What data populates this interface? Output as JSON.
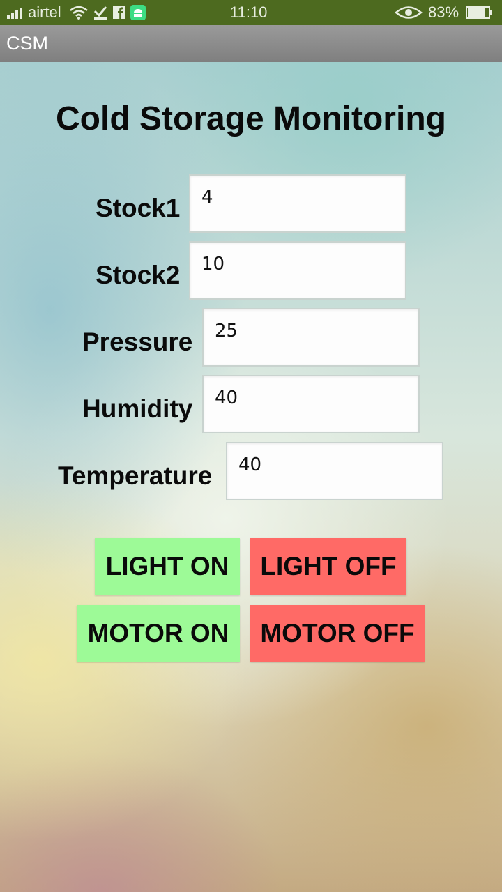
{
  "status_bar": {
    "carrier": "airtel",
    "time": "11:10",
    "battery_percent": "83%",
    "battery_level": 0.83,
    "icons": [
      "signal-icon",
      "wifi-icon",
      "download-check-icon",
      "facebook-icon",
      "android-icon",
      "eye-icon",
      "battery-icon"
    ]
  },
  "app_bar": {
    "title": "CSM"
  },
  "main": {
    "title": "Cold Storage Monitoring",
    "fields": [
      {
        "label": "Stock1",
        "value": "4"
      },
      {
        "label": "Stock2",
        "value": "10"
      },
      {
        "label": "Pressure",
        "value": "25"
      },
      {
        "label": "Humidity",
        "value": "40"
      },
      {
        "label": "Temperature",
        "value": "40"
      }
    ],
    "buttons": {
      "light_on": "LIGHT ON",
      "light_off": "LIGHT OFF",
      "motor_on": "MOTOR ON",
      "motor_off": "MOTOR OFF"
    }
  },
  "colors": {
    "status_bar": "#4d6a1f",
    "on_button": "#9dfa97",
    "off_button": "#ff6a66"
  }
}
